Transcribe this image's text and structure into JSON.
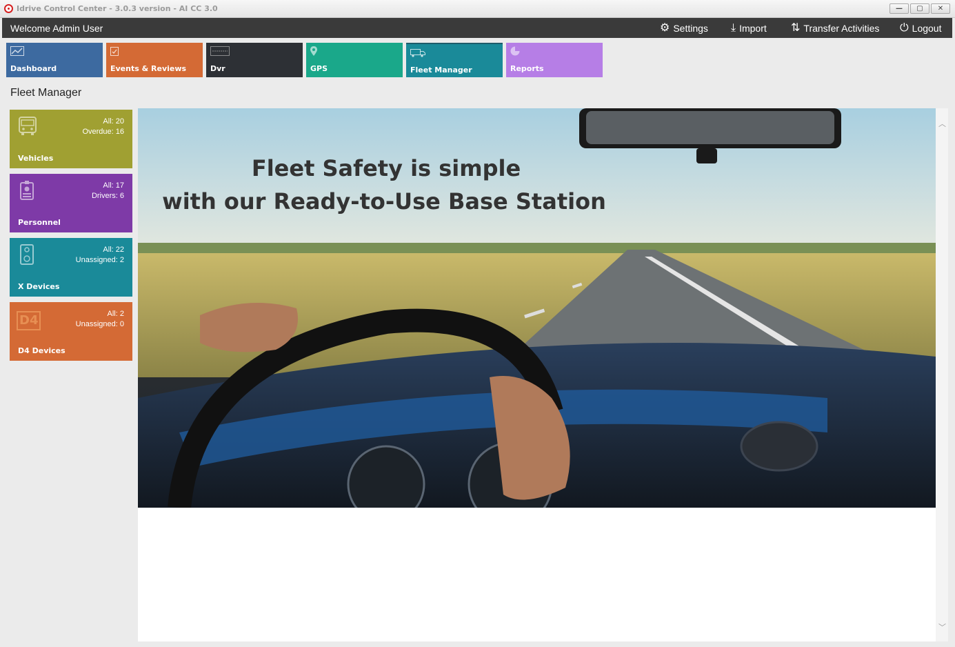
{
  "window": {
    "title": "Idrive Control Center - 3.0.3 version - AI CC 3.0",
    "minimize": "—",
    "maximize": "▢",
    "close": "✕"
  },
  "header": {
    "welcome": "Welcome Admin User",
    "nav": {
      "settings": "Settings",
      "import": "Import",
      "transfer": "Transfer Activities",
      "logout": "Logout"
    }
  },
  "tiles": [
    {
      "label": "Dashboard",
      "icon": "chart-icon",
      "color": "#3d6aa0"
    },
    {
      "label": "Events & Reviews",
      "icon": "clipboard-icon",
      "color": "#d46a35"
    },
    {
      "label": "Dvr",
      "icon": "dvr-icon",
      "color": "#2d3035"
    },
    {
      "label": "GPS",
      "icon": "map-pin-icon",
      "color": "#1aa88a"
    },
    {
      "label": "Fleet Manager",
      "icon": "truck-icon",
      "color": "#1a8a99"
    },
    {
      "label": "Reports",
      "icon": "pie-chart-icon",
      "color": "#b67ee6"
    }
  ],
  "page_title": "Fleet Manager",
  "cards": [
    {
      "label": "Vehicles",
      "line1": "All: 20",
      "line2": "Overdue: 16",
      "icon": "bus-icon",
      "color": "#a0a032"
    },
    {
      "label": "Personnel",
      "line1": "All: 17",
      "line2": "Drivers: 6",
      "icon": "badge-icon",
      "color": "#7e3aa7"
    },
    {
      "label": "X Devices",
      "line1": "All: 22",
      "line2": "Unassigned: 2",
      "icon": "device-icon",
      "color": "#1a8a99"
    },
    {
      "label": "D4 Devices",
      "line1": "All: 2",
      "line2": "Unassigned: 0",
      "icon": "d4-icon",
      "icon_text": "D4",
      "color": "#d46a35"
    }
  ],
  "banner": {
    "line1": "Fleet Safety is simple",
    "line2": "with our Ready-to-Use Base Station"
  }
}
